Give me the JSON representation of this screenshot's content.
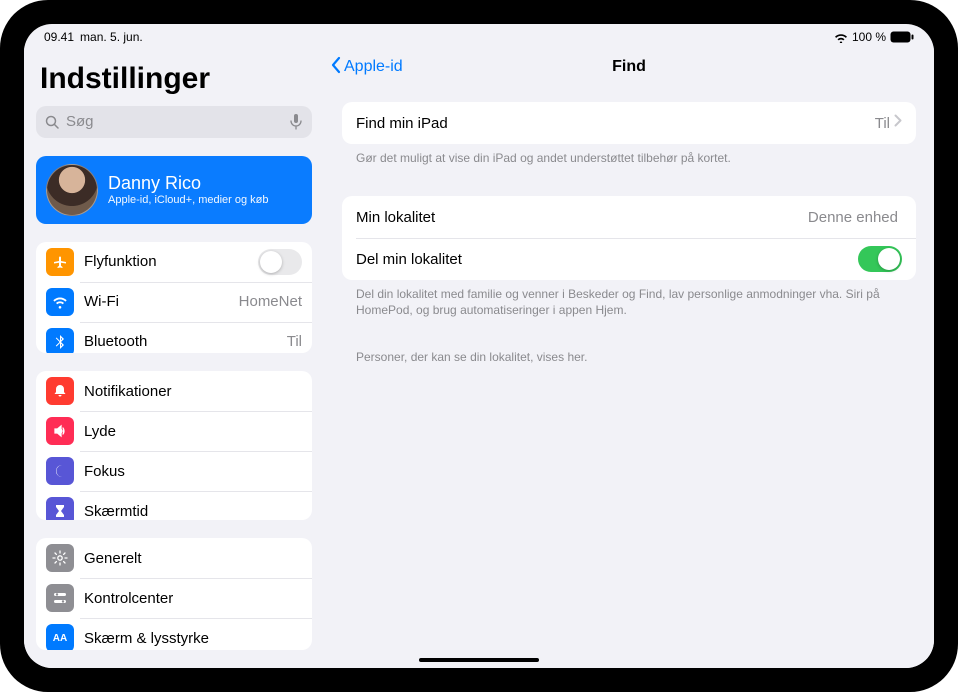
{
  "status": {
    "time": "09.41",
    "date": "man. 5. jun.",
    "battery": "100 %"
  },
  "sidebar": {
    "title": "Indstillinger",
    "search_placeholder": "Søg",
    "profile": {
      "name": "Danny Rico",
      "subtitle": "Apple-id, iCloud+, medier og køb"
    },
    "group1": {
      "airplane": "Flyfunktion",
      "wifi": "Wi-Fi",
      "wifi_value": "HomeNet",
      "bluetooth": "Bluetooth",
      "bluetooth_value": "Til"
    },
    "group2": {
      "notifications": "Notifikationer",
      "sounds": "Lyde",
      "focus": "Fokus",
      "screentime": "Skærmtid"
    },
    "group3": {
      "general": "Generelt",
      "controlcenter": "Kontrolcenter",
      "display": "Skærm & lysstyrke"
    }
  },
  "nav": {
    "back": "Apple-id",
    "title": "Find"
  },
  "content": {
    "find_ipad_label": "Find min iPad",
    "find_ipad_value": "Til",
    "find_ipad_footer": "Gør det muligt at vise din iPad og andet understøttet tilbehør på kortet.",
    "my_location_label": "Min lokalitet",
    "my_location_value": "Denne enhed",
    "share_location_label": "Del min lokalitet",
    "share_location_footer": "Del din lokalitet med familie og venner i Beskeder og Find, lav personlige anmodninger vha. Siri på HomePod, og brug automatiseringer i appen Hjem.",
    "people_footer": "Personer, der kan se din lokalitet, vises her."
  }
}
